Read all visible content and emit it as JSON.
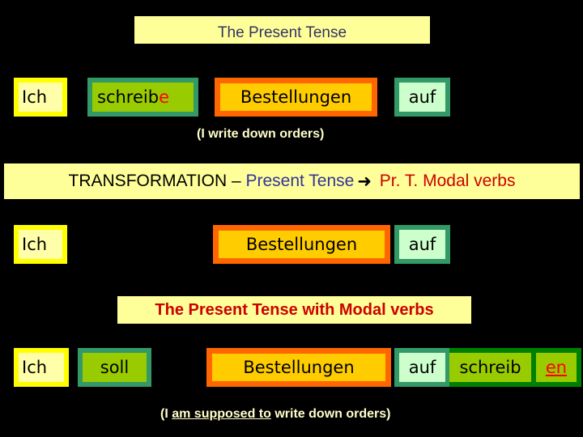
{
  "slide": {
    "background": "#000000",
    "title": {
      "text": "The Present Tense",
      "color": "#333366"
    },
    "row1": {
      "subject": "Ich",
      "verb_stem": "schreib",
      "verb_ending": "e",
      "object": "Bestellungen",
      "particle": "auf",
      "translation": "(I write down orders)"
    },
    "transformation_banner": {
      "part1": "TRANSFORMATION – ",
      "part2": "Present Tense",
      "arrow_icon": "right-arrow-icon",
      "arrow_glyph": "➜",
      "part3": " Pr. T. Modal verbs",
      "colors": {
        "part1": "#000000",
        "part2": "#333399",
        "part3": "#CC0000"
      }
    },
    "row2": {
      "subject": "Ich",
      "object": "Bestellungen",
      "particle": "auf"
    },
    "modal_banner": {
      "text": "The Present Tense with Modal verbs",
      "color": "#CC0000"
    },
    "row3": {
      "subject": "Ich",
      "modal": "soll",
      "object": "Bestellungen",
      "particle": "auf",
      "infinitive_stem": "schreib",
      "infinitive_ending": "en",
      "translation_open": "(I ",
      "translation_underlined": "am supposed to",
      "translation_rest": " write down orders)"
    },
    "box_colors": {
      "subject_border": "#FFFF00",
      "subject_fill": "#FFFFAA",
      "verb_border": "#339966",
      "verb_fill": "#99CC00",
      "object_border": "#FF6600",
      "object_fill": "#FFCC00",
      "particle_border": "#339966",
      "particle_fill": "#CCFFCC",
      "infinitive_border": "#008000",
      "ending_color": "#FF0000"
    }
  }
}
